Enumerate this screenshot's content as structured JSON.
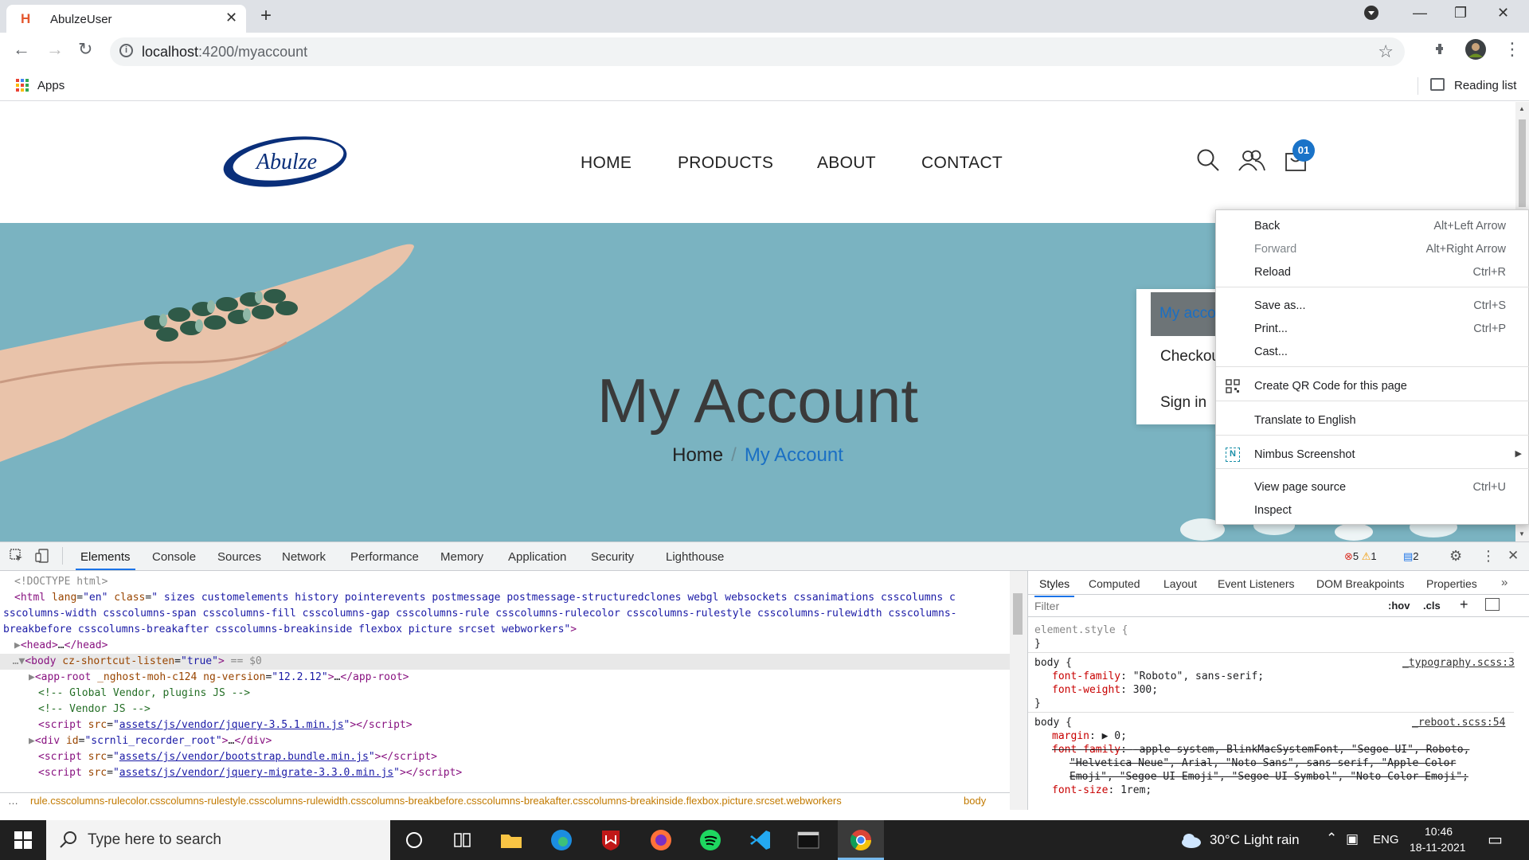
{
  "browser": {
    "tab_title": "AbulzeUser",
    "tab_favicon": "H",
    "url_host": "localhost",
    "url_rest": ":4200/myaccount",
    "bookmarks_apps": "Apps",
    "reading_list": "Reading list"
  },
  "site": {
    "logo_text": "Abulze",
    "nav": [
      "HOME",
      "PRODUCTS",
      "ABOUT",
      "CONTACT"
    ],
    "cart_count": "01",
    "hero_title": "My Account",
    "breadcrumb_home": "Home",
    "breadcrumb_sep": "/",
    "breadcrumb_current": "My Account",
    "account_menu": [
      "My account",
      "Checkout",
      "Sign in"
    ]
  },
  "context_menu": {
    "items": [
      {
        "label": "Back",
        "shortcut": "Alt+Left Arrow"
      },
      {
        "label": "Forward",
        "shortcut": "Alt+Right Arrow"
      },
      {
        "label": "Reload",
        "shortcut": "Ctrl+R"
      },
      {
        "label": "Save as...",
        "shortcut": "Ctrl+S"
      },
      {
        "label": "Print...",
        "shortcut": "Ctrl+P"
      },
      {
        "label": "Cast...",
        "shortcut": ""
      },
      {
        "label": "Create QR Code for this page",
        "shortcut": ""
      },
      {
        "label": "Translate to English",
        "shortcut": ""
      },
      {
        "label": "Nimbus Screenshot",
        "shortcut": ""
      },
      {
        "label": "View page source",
        "shortcut": "Ctrl+U"
      },
      {
        "label": "Inspect",
        "shortcut": ""
      }
    ]
  },
  "devtools": {
    "tabs": [
      "Elements",
      "Console",
      "Sources",
      "Network",
      "Performance",
      "Memory",
      "Application",
      "Security",
      "Lighthouse"
    ],
    "errors": "5",
    "warnings": "1",
    "messages": "2",
    "side_tabs": [
      "Styles",
      "Computed",
      "Layout",
      "Event Listeners",
      "DOM Breakpoints",
      "Properties"
    ],
    "filter_placeholder": "Filter",
    "hov": ":hov",
    "cls": ".cls",
    "breadcrumb_path": "rule.csscolumns-rulecolor.csscolumns-rulestyle.csscolumns-rulewidth.csscolumns-breakbefore.csscolumns-breakafter.csscolumns-breakinside.flexbox.picture.srcset.webworkers",
    "breadcrumb_body": "body",
    "doctype": "<!DOCTYPE html>",
    "html_classes_1": " sizes customelements history pointerevents postmessage postmessage-structuredclones webgl websockets cssanimations csscolumns c",
    "html_classes_2": "sscolumns-width csscolumns-span csscolumns-fill csscolumns-gap csscolumns-rule csscolumns-rulecolor csscolumns-rulestyle csscolumns-rulewidth csscolumns-",
    "html_classes_3": "breakbefore csscolumns-breakafter csscolumns-breakinside flexbox picture srcset webworkers",
    "ng_version": "12.2.12",
    "comment_1": "<!-- Global Vendor, plugins JS -->",
    "comment_2": "<!-- Vendor JS -->",
    "script_1": "assets/js/vendor/jquery-3.5.1.min.js",
    "script_2": "assets/js/vendor/bootstrap.bundle.min.js",
    "script_3": "assets/js/vendor/jquery-migrate-3.3.0.min.js",
    "recorder_id": "scrnli_recorder_root",
    "styles": {
      "element_style": "element.style {",
      "rule1_source": "_typography.scss:3",
      "rule1_font_family": "\"Roboto\", sans-serif;",
      "rule1_font_weight": "300;",
      "rule2_source": "_reboot.scss:54",
      "rule2_margin": "0;",
      "rule2_font_family_1": "-apple-system, BlinkMacSystemFont, \"Segoe UI\", Roboto,",
      "rule2_font_family_2": "\"Helvetica Neue\", Arial, \"Noto Sans\", sans-serif, \"Apple Color",
      "rule2_font_family_3": "Emoji\", \"Segoe UI Emoji\", \"Segoe UI Symbol\", \"Noto Color Emoji\";",
      "rule2_font_size": "1rem;"
    }
  },
  "taskbar": {
    "search_placeholder": "Type here to search",
    "weather": "30°C  Light rain",
    "lang": "ENG",
    "time": "10:46",
    "date": "18-11-2021"
  },
  "colors": {
    "hero_bg": "#7ab3c1",
    "accent_blue": "#1a6fc4",
    "cart_badge": "#1a73c8"
  }
}
